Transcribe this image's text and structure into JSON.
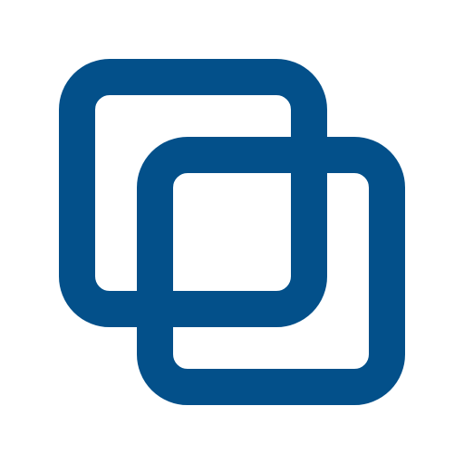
{
  "icon": {
    "name": "overlapping-squares-icon",
    "color": "#03508a",
    "background": "#ffffff"
  }
}
